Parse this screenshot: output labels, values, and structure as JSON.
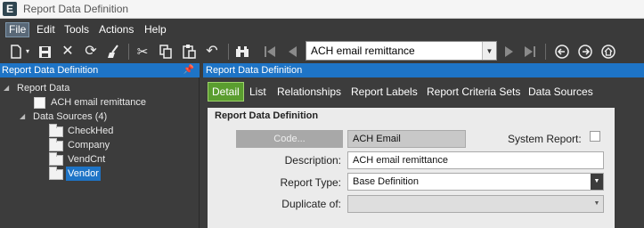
{
  "window": {
    "title": "Report Data Definition",
    "app_icon": "E"
  },
  "menu": [
    "File",
    "Edit",
    "Tools",
    "Actions",
    "Help"
  ],
  "toolbar": {
    "icons": [
      "new-icon",
      "save-icon",
      "delete-icon",
      "refresh-icon",
      "clear-icon",
      "cut-icon",
      "copy-icon",
      "paste-icon",
      "undo-icon",
      "search-icon",
      "first-icon",
      "prev-icon",
      "next-icon",
      "last-icon",
      "back-icon",
      "forward-icon",
      "home-icon"
    ],
    "record_selector": "ACH email remittance"
  },
  "tree": {
    "header": "Report Data Definition",
    "root_label": "Report Data",
    "definition_label": "ACH email remittance",
    "data_sources_label": "Data Sources (4)",
    "sources": [
      "CheckHed",
      "Company",
      "VendCnt",
      "Vendor"
    ],
    "selected_source": "Vendor"
  },
  "detail_panel": {
    "header": "Report Data Definition",
    "tabs": [
      "Detail",
      "List",
      "Relationships",
      "Report Labels",
      "Report Criteria Sets",
      "Data Sources"
    ],
    "active_tab": "Detail"
  },
  "form": {
    "section_title": "Report Data Definition",
    "code_button": "Code...",
    "code_value": "ACH Email",
    "system_report_label": "System Report:",
    "system_report_checked": false,
    "description_label": "Description:",
    "description_value": "ACH email remittance",
    "report_type_label": "Report Type:",
    "report_type_value": "Base Definition",
    "duplicate_of_label": "Duplicate of:",
    "duplicate_of_value": ""
  },
  "colors": {
    "header_blue": "#1e74c6",
    "active_tab_green": "#5a9d2f",
    "dark_bg": "#3c3c3c"
  }
}
